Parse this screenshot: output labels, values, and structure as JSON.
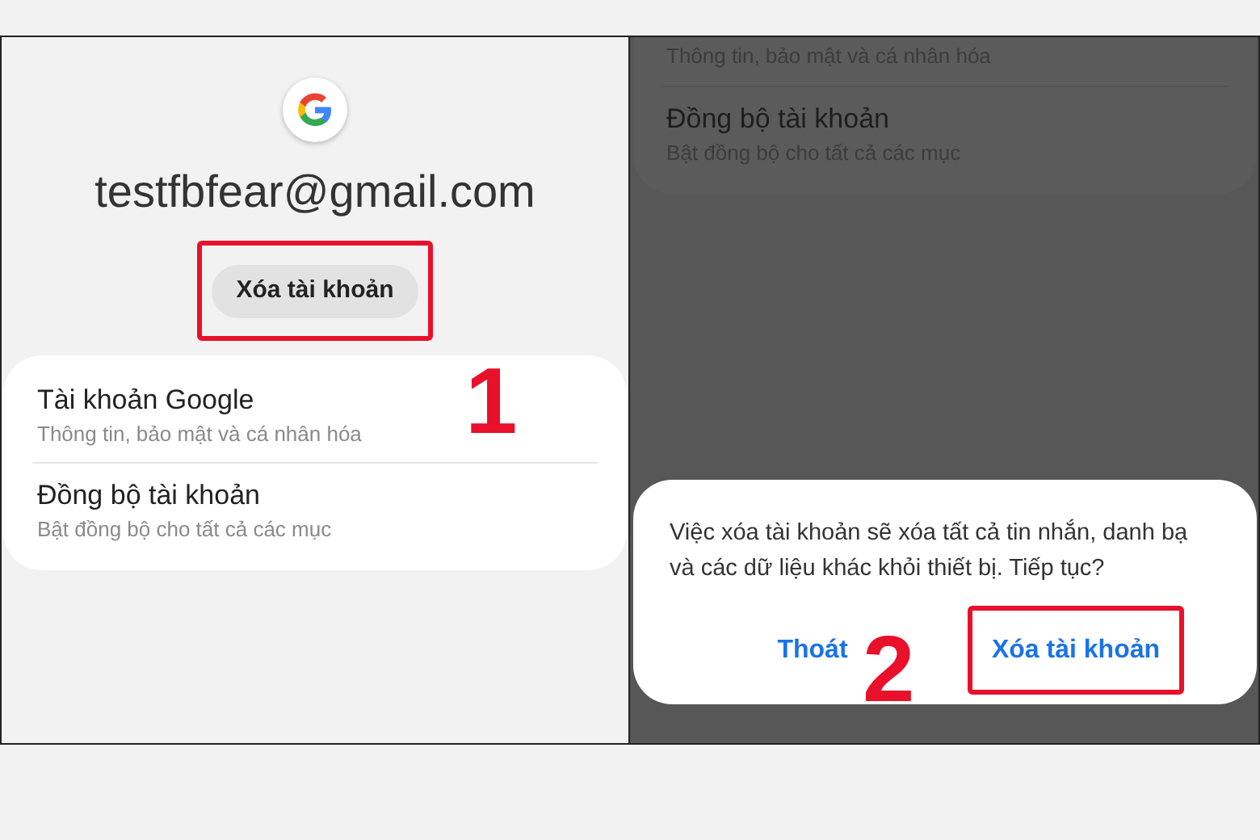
{
  "left": {
    "account_email": "testfbfear@gmail.com",
    "remove_button": {
      "label": "Xóa tài khoản",
      "highlighted": true
    },
    "step_label": "1",
    "items": [
      {
        "title": "Tài khoản Google",
        "subtitle": "Thông tin, bảo mật và cá nhân hóa"
      },
      {
        "title": "Đồng bộ tài khoản",
        "subtitle": "Bật đồng bộ cho tất cả các mục"
      }
    ]
  },
  "right": {
    "partial_subtitle": "Thông tin, bảo mật và cá nhân hóa",
    "items": [
      {
        "title": "Đồng bộ tài khoản",
        "subtitle": "Bật đồng bộ cho tất cả các mục"
      }
    ],
    "dialog": {
      "message": "Việc xóa tài khoản sẽ xóa tất cả tin nhắn, danh bạ và các dữ liệu khác khỏi thiết bị. Tiếp tục?",
      "buttons": [
        {
          "label": "Thoát",
          "highlighted": false
        },
        {
          "label": "Xóa tài khoản",
          "highlighted": true
        }
      ]
    },
    "step_label": "2"
  }
}
